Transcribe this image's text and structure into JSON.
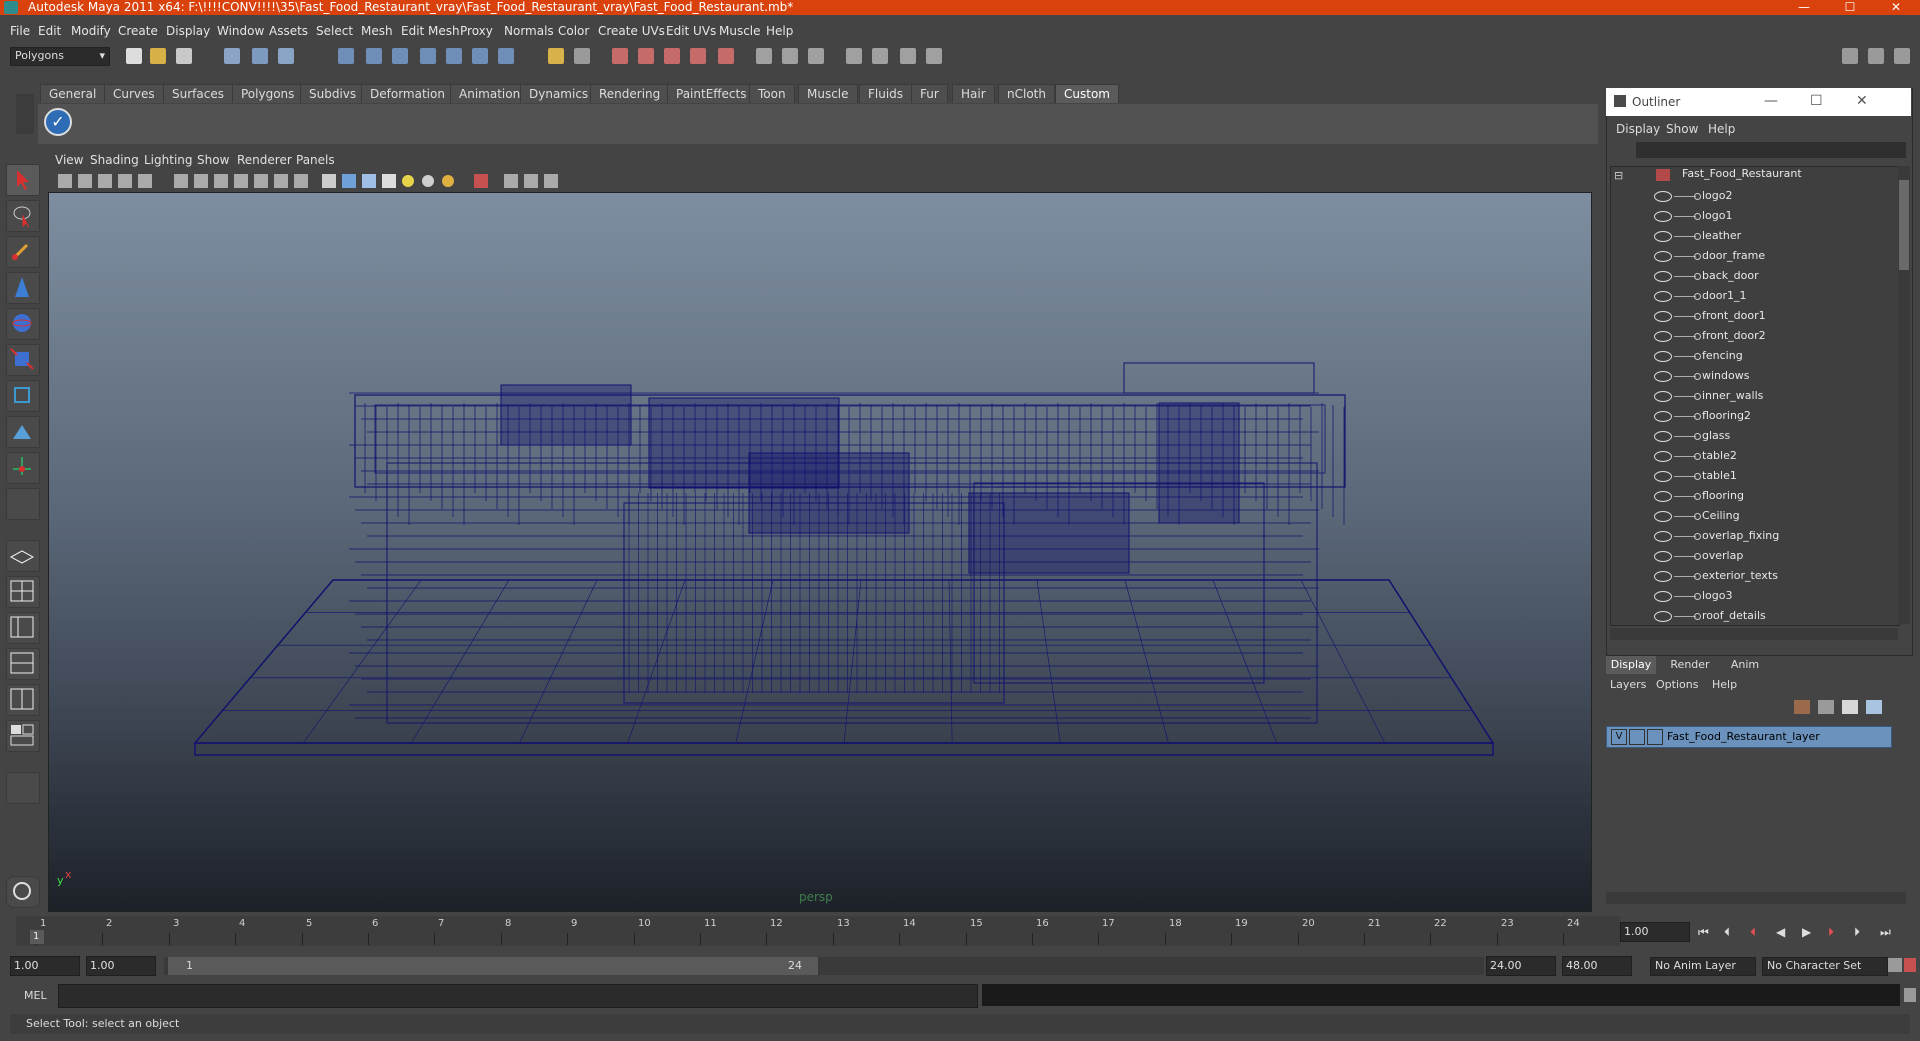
{
  "window": {
    "title": "Autodesk Maya 2011 x64: F:\\!!!!CONV!!!!\\35\\Fast_Food_Restaurant_vray\\Fast_Food_Restaurant_vray\\Fast_Food_Restaurant.mb*",
    "minimize": "—",
    "maximize": "☐",
    "close": "✕"
  },
  "menubar": [
    "File",
    "Edit",
    "Modify",
    "Create",
    "Display",
    "Window",
    "Assets",
    "Select",
    "Mesh",
    "Edit Mesh",
    "Proxy",
    "Normals",
    "Color",
    "Create UVs",
    "Edit UVs",
    "Muscle",
    "Help"
  ],
  "statusline": {
    "mode": "Polygons"
  },
  "shelf": {
    "tabs": [
      "General",
      "Curves",
      "Surfaces",
      "Polygons",
      "Subdivs",
      "Deformation",
      "Animation",
      "Dynamics",
      "Rendering",
      "PaintEffects",
      "Toon",
      "Muscle",
      "Fluids",
      "Fur",
      "Hair",
      "nCloth",
      "Custom"
    ],
    "active_tab": "Custom"
  },
  "viewport": {
    "menu": [
      "View",
      "Shading",
      "Lighting",
      "Show",
      "Renderer",
      "Panels"
    ],
    "camera_label": "persp",
    "axis_y": "y",
    "axis_x": "x",
    "wire_color": "#12126e"
  },
  "outliner": {
    "title": "Outliner",
    "menu": [
      "Display",
      "Show",
      "Help"
    ],
    "root": "Fast_Food_Restaurant",
    "items": [
      "logo2",
      "logo1",
      "leather",
      "door_frame",
      "back_door",
      "door1_1",
      "front_door1",
      "front_door2",
      "fencing",
      "windows",
      "inner_walls",
      "flooring2",
      "glass",
      "table2",
      "table1",
      "flooring",
      "Ceiling",
      "overlap_fixing",
      "overlap",
      "exterior_texts",
      "logo3",
      "roof_details"
    ]
  },
  "layer_editor": {
    "tabs": [
      "Display",
      "Render",
      "Anim"
    ],
    "active_tab": "Display",
    "menu": [
      "Layers",
      "Options",
      "Help"
    ],
    "layer": {
      "visible": "V",
      "name": "Fast_Food_Restaurant_layer"
    }
  },
  "timeline": {
    "ticks": [
      "1",
      "2",
      "3",
      "4",
      "5",
      "6",
      "7",
      "8",
      "9",
      "10",
      "11",
      "12",
      "13",
      "14",
      "15",
      "16",
      "17",
      "18",
      "19",
      "20",
      "21",
      "22",
      "23",
      "24"
    ],
    "current_frame_marker": "1",
    "current_time": "1.00"
  },
  "range": {
    "start": "1.00",
    "playback_start": "1.00",
    "slider_left": "1",
    "slider_right": "24",
    "playback_end": "24.00",
    "end": "48.00",
    "anim_layer": "No Anim Layer",
    "char_set": "No Character Set"
  },
  "command": {
    "label": "MEL"
  },
  "help_line": "Select Tool: select an object"
}
